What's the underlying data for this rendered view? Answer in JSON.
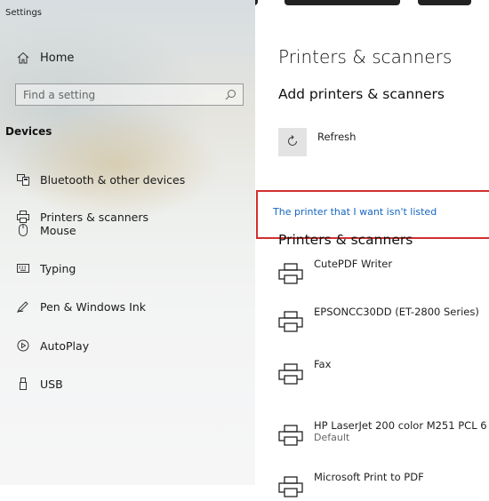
{
  "window": {
    "title": "Settings"
  },
  "sidebar": {
    "home_label": "Home",
    "search_placeholder": "Find a setting",
    "section_title": "Devices",
    "items": [
      {
        "label": "Bluetooth & other devices",
        "icon": "bluetooth-devices-icon"
      },
      {
        "label": "Printers & scanners",
        "icon": "printer-icon"
      },
      {
        "label": "Mouse",
        "icon": "mouse-icon"
      },
      {
        "label": "Typing",
        "icon": "keyboard-icon"
      },
      {
        "label": "Pen & Windows Ink",
        "icon": "pen-icon"
      },
      {
        "label": "AutoPlay",
        "icon": "autoplay-icon"
      },
      {
        "label": "USB",
        "icon": "usb-icon"
      }
    ]
  },
  "main": {
    "title": "Printers & scanners",
    "add_title": "Add printers & scanners",
    "refresh_label": "Refresh",
    "missing_printer_link": "The printer that I want isn't listed",
    "list_title": "Printers & scanners",
    "printers": [
      {
        "name": "CutePDF Writer",
        "status": ""
      },
      {
        "name": "EPSONCC30DD (ET-2800 Series)",
        "status": ""
      },
      {
        "name": "Fax",
        "status": ""
      },
      {
        "name": "HP LaserJet 200 color M251 PCL 6",
        "status": "Default"
      },
      {
        "name": "Microsoft Print to PDF",
        "status": ""
      }
    ]
  },
  "colors": {
    "highlight_border": "#d32f2f",
    "link": "#1565c0"
  }
}
